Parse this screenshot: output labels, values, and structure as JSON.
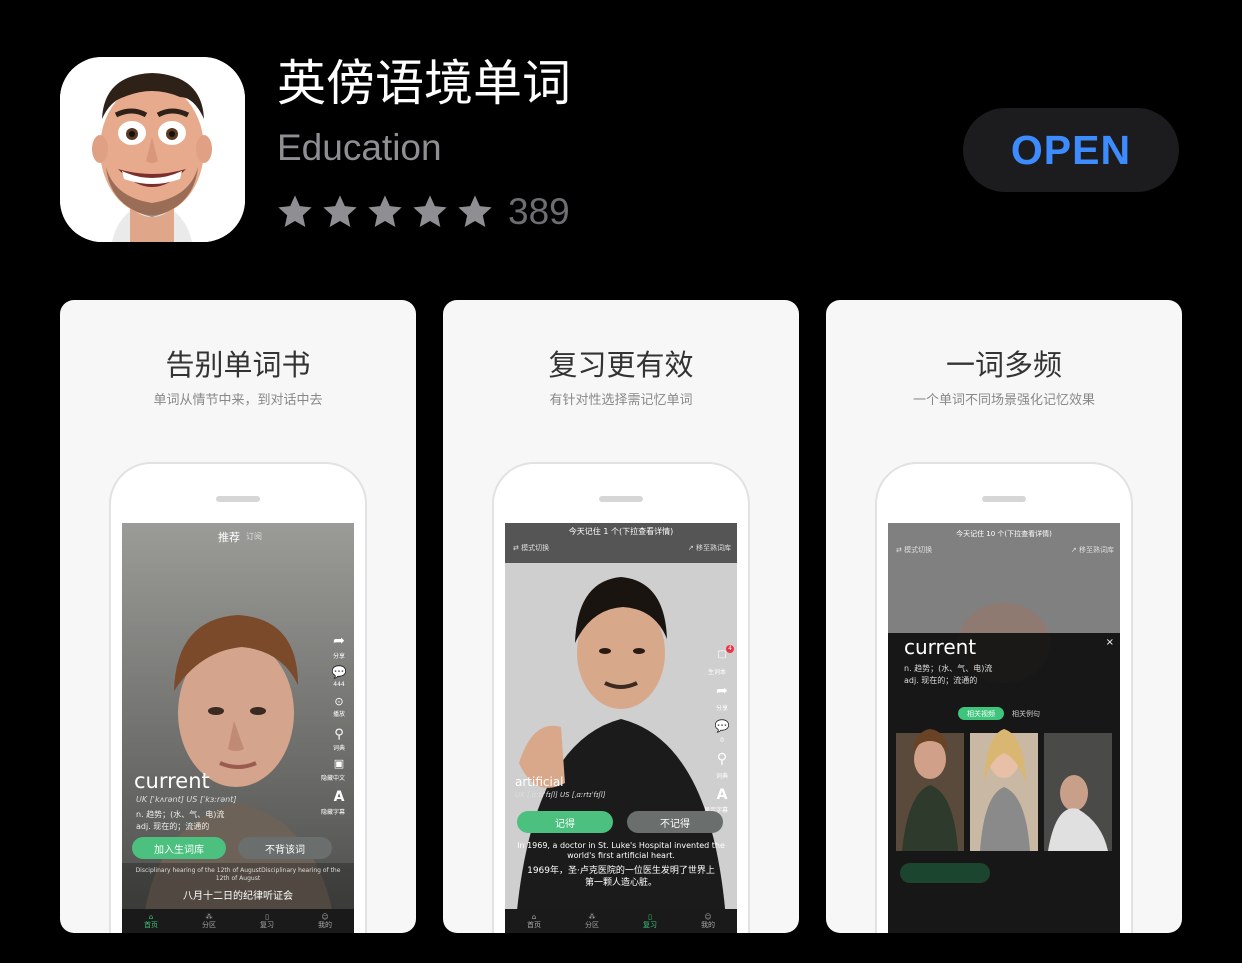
{
  "app": {
    "title": "英傍语境单词",
    "category": "Education",
    "rating_count": "389",
    "stars": 5,
    "open_label": "OPEN"
  },
  "colors": {
    "accent": "#3d8cff",
    "green": "#3fc47b",
    "star": "#8e8e93"
  },
  "screenshots": [
    {
      "title": "告别单词书",
      "subtitle": "单词从情节中来，到对话中去",
      "header_main": "推荐",
      "header_sub": "订阅",
      "side": [
        "分享",
        "444",
        "播放",
        "词典",
        "隐藏中文",
        "隐藏字幕"
      ],
      "word": "current",
      "phon": "UK [ˈkʌrənt]   US [ˈkɜːrənt]",
      "def1": "n.  趋势；(水、气、电)流",
      "def2": "adj.  现在的；流通的",
      "btn1": "加入生词库",
      "btn2": "不背该词",
      "caption_en": "Disciplinary hearing of the 12th of AugustDisciplinary hearing of the 12th of August",
      "caption_zh": "八月十二日的纪律听证会",
      "nav": [
        "首页",
        "分区",
        "复习",
        "我的"
      ]
    },
    {
      "title": "复习更有效",
      "subtitle": "有针对性选择需记忆单词",
      "top": "今天记住 1 个(下拉查看详情)",
      "mode": "⇄ 模式切换",
      "move": "↗ 移至熟词库",
      "side": [
        "4",
        "生词本",
        "分享",
        "0",
        "词典",
        "显示字幕"
      ],
      "word": "artificial",
      "phon": "UK [ˌɑːtɪˈfɪʃl]  US [ˌɑːrtɪˈfɪʃl]",
      "btn1": "记得",
      "btn2": "不记得",
      "caption_en": "In 1969, a doctor in St. Luke's Hospital invented the world's first artificial heart.",
      "caption_zh": "1969年，圣·卢克医院的一位医生发明了世界上第一颗人造心脏。",
      "nav": [
        "首页",
        "分区",
        "复习",
        "我的"
      ]
    },
    {
      "title": "一词多频",
      "subtitle": "一个单词不同场景强化记忆效果",
      "top": "今天记住 10 个(下拉查看详情)",
      "mode": "⇄ 模式切换",
      "move": "↗ 移至熟词库",
      "word": "current",
      "def1": "n.  趋势；(水、气、电)流",
      "def2": "adj.  现在的；流通的",
      "tab1": "相关视频",
      "tab2": "相关例句",
      "close": "×"
    }
  ]
}
